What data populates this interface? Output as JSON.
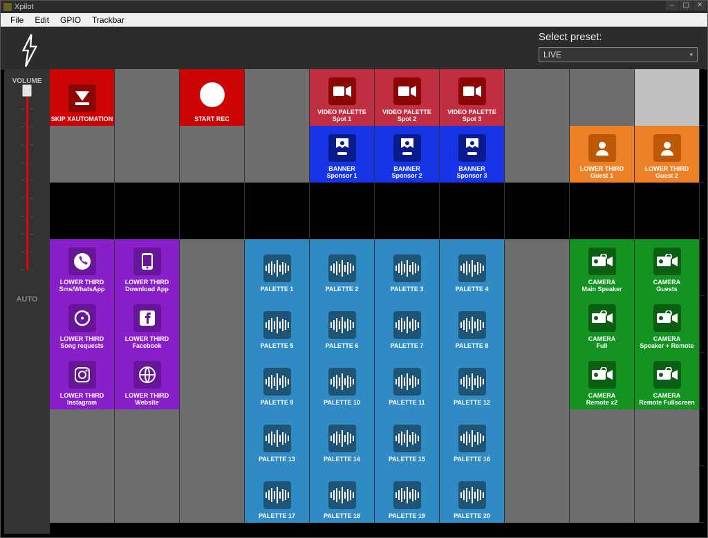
{
  "window": {
    "title": "Xpilot"
  },
  "menu": [
    "File",
    "Edit",
    "GPIO",
    "Trackbar"
  ],
  "preset": {
    "label": "Select preset:",
    "value": "LIVE"
  },
  "sidebar": {
    "volume_label": "VOLUME",
    "auto_label": "AUTO"
  },
  "grid": {
    "rows": [
      [
        {
          "bg": "c-red",
          "line1": "SKIP XAUTOMATION",
          "line2": "",
          "icon": "download-triangle",
          "ib": "ib-darkred",
          "name": "btn-skip-xautomation"
        },
        {
          "bg": "grey"
        },
        {
          "bg": "c-red",
          "line1": "START REC",
          "line2": "",
          "icon": "circle-plain",
          "ib": "",
          "name": "btn-start-rec"
        },
        {
          "bg": "grey"
        },
        {
          "bg": "c-crim",
          "line1": "VIDEO PALETTE",
          "line2": "Spot 1",
          "icon": "video-cam",
          "ib": "ib-darkred",
          "name": "btn-video-palette-1"
        },
        {
          "bg": "c-crim",
          "line1": "VIDEO PALETTE",
          "line2": "Spot 2",
          "icon": "video-cam",
          "ib": "ib-darkred",
          "name": "btn-video-palette-2"
        },
        {
          "bg": "c-crim",
          "line1": "VIDEO PALETTE",
          "line2": "Spot 3",
          "icon": "video-cam",
          "ib": "ib-darkred",
          "name": "btn-video-palette-3"
        },
        {
          "bg": "grey"
        },
        {
          "bg": "grey"
        },
        {
          "bg": "ltgrey"
        }
      ],
      [
        {
          "bg": "grey"
        },
        {
          "bg": "grey"
        },
        {
          "bg": "grey"
        },
        {
          "bg": "grey"
        },
        {
          "bg": "c-blue",
          "line1": "BANNER",
          "line2": "Sponsor 1",
          "icon": "banner-person",
          "ib": "ib-darkblue",
          "name": "btn-banner-1"
        },
        {
          "bg": "c-blue",
          "line1": "BANNER",
          "line2": "Sponsor 2",
          "icon": "banner-person",
          "ib": "ib-darkblue",
          "name": "btn-banner-2"
        },
        {
          "bg": "c-blue",
          "line1": "BANNER",
          "line2": "Sponsor 3",
          "icon": "banner-person",
          "ib": "ib-darkblue",
          "name": "btn-banner-3"
        },
        {
          "bg": "grey"
        },
        {
          "bg": "c-orange",
          "line1": "LOWER THIRD",
          "line2": "Guest 1",
          "icon": "user-card",
          "ib": "ib-dorange",
          "name": "btn-lower-third-guest-1"
        },
        {
          "bg": "c-orange",
          "line1": "LOWER THIRD",
          "line2": "Guest 2",
          "icon": "user-card",
          "ib": "ib-dorange",
          "name": "btn-lower-third-guest-2"
        }
      ],
      [
        {
          "bg": "empty"
        },
        {
          "bg": "empty"
        },
        {
          "bg": "empty"
        },
        {
          "bg": "empty"
        },
        {
          "bg": "empty"
        },
        {
          "bg": "empty"
        },
        {
          "bg": "empty"
        },
        {
          "bg": "empty"
        },
        {
          "bg": "empty"
        },
        {
          "bg": "empty"
        }
      ],
      [
        {
          "bg": "c-purple",
          "line1": "LOWER THIRD",
          "line2": "Sms/WhatsApp",
          "icon": "phone-circle",
          "ib": "ib-darkpurple",
          "name": "btn-lt-sms"
        },
        {
          "bg": "c-purple",
          "line1": "LOWER THIRD",
          "line2": "Download App",
          "icon": "phone-rect",
          "ib": "ib-darkpurple",
          "name": "btn-lt-download"
        },
        {
          "bg": "grey"
        },
        {
          "bg": "c-steel",
          "line1": "PALETTE 1",
          "line2": "",
          "icon": "wave",
          "ib": "ib-teal",
          "name": "btn-palette-1"
        },
        {
          "bg": "c-steel",
          "line1": "PALETTE 2",
          "line2": "",
          "icon": "wave",
          "ib": "ib-teal",
          "name": "btn-palette-2"
        },
        {
          "bg": "c-steel",
          "line1": "PALETTE 3",
          "line2": "",
          "icon": "wave",
          "ib": "ib-teal",
          "name": "btn-palette-3"
        },
        {
          "bg": "c-steel",
          "line1": "PALETTE 4",
          "line2": "",
          "icon": "wave",
          "ib": "ib-teal",
          "name": "btn-palette-4"
        },
        {
          "bg": "grey"
        },
        {
          "bg": "c-green",
          "line1": "CAMERA",
          "line2": "Main Speaker",
          "icon": "camera",
          "ib": "ib-dgreen",
          "name": "btn-cam-main"
        },
        {
          "bg": "c-green",
          "line1": "CAMERA",
          "line2": "Guests",
          "icon": "camera",
          "ib": "ib-dgreen",
          "name": "btn-cam-guests"
        }
      ],
      [
        {
          "bg": "c-purple",
          "line1": "LOWER THIRD",
          "line2": "Song requests",
          "icon": "disc",
          "ib": "ib-darkpurple",
          "name": "btn-lt-song"
        },
        {
          "bg": "c-purple",
          "line1": "LOWER THIRD",
          "line2": "Facebook",
          "icon": "facebook",
          "ib": "ib-darkpurple",
          "name": "btn-lt-facebook"
        },
        {
          "bg": "grey"
        },
        {
          "bg": "c-steel",
          "line1": "PALETTE 5",
          "line2": "",
          "icon": "wave",
          "ib": "ib-teal",
          "name": "btn-palette-5"
        },
        {
          "bg": "c-steel",
          "line1": "PALETTE 6",
          "line2": "",
          "icon": "wave",
          "ib": "ib-teal",
          "name": "btn-palette-6"
        },
        {
          "bg": "c-steel",
          "line1": "PALETTE 7",
          "line2": "",
          "icon": "wave",
          "ib": "ib-teal",
          "name": "btn-palette-7"
        },
        {
          "bg": "c-steel",
          "line1": "PALETTE 8",
          "line2": "",
          "icon": "wave",
          "ib": "ib-teal",
          "name": "btn-palette-8"
        },
        {
          "bg": "grey"
        },
        {
          "bg": "c-green",
          "line1": "CAMERA",
          "line2": "Full",
          "icon": "camera",
          "ib": "ib-dgreen",
          "name": "btn-cam-full"
        },
        {
          "bg": "c-green",
          "line1": "CAMERA",
          "line2": "Speaker + Remote",
          "icon": "camera",
          "ib": "ib-dgreen",
          "name": "btn-cam-speaker-remote"
        }
      ],
      [
        {
          "bg": "c-purple",
          "line1": "LOWER THIRD",
          "line2": "Instagram",
          "icon": "instagram",
          "ib": "ib-darkpurple",
          "name": "btn-lt-instagram"
        },
        {
          "bg": "c-purple",
          "line1": "LOWER THIRD",
          "line2": "Website",
          "icon": "globe",
          "ib": "ib-darkpurple",
          "name": "btn-lt-website"
        },
        {
          "bg": "grey"
        },
        {
          "bg": "c-steel",
          "line1": "PALETTE 9",
          "line2": "",
          "icon": "wave",
          "ib": "ib-teal",
          "name": "btn-palette-9"
        },
        {
          "bg": "c-steel",
          "line1": "PALETTE 10",
          "line2": "",
          "icon": "wave",
          "ib": "ib-teal",
          "name": "btn-palette-10"
        },
        {
          "bg": "c-steel",
          "line1": "PALETTE 11",
          "line2": "",
          "icon": "wave",
          "ib": "ib-teal",
          "name": "btn-palette-11"
        },
        {
          "bg": "c-steel",
          "line1": "PALETTE 12",
          "line2": "",
          "icon": "wave",
          "ib": "ib-teal",
          "name": "btn-palette-12"
        },
        {
          "bg": "grey"
        },
        {
          "bg": "c-green",
          "line1": "CAMERA",
          "line2": "Remote x2",
          "icon": "camera",
          "ib": "ib-dgreen",
          "name": "btn-cam-remote-x2"
        },
        {
          "bg": "c-green",
          "line1": "CAMERA",
          "line2": "Remote Fullscreen",
          "icon": "camera",
          "ib": "ib-dgreen",
          "name": "btn-cam-remote-full"
        }
      ],
      [
        {
          "bg": "grey"
        },
        {
          "bg": "grey"
        },
        {
          "bg": "grey"
        },
        {
          "bg": "c-steel",
          "line1": "PALETTE 13",
          "line2": "",
          "icon": "wave",
          "ib": "ib-teal",
          "name": "btn-palette-13"
        },
        {
          "bg": "c-steel",
          "line1": "PALETTE 14",
          "line2": "",
          "icon": "wave",
          "ib": "ib-teal",
          "name": "btn-palette-14"
        },
        {
          "bg": "c-steel",
          "line1": "PALETTE 15",
          "line2": "",
          "icon": "wave",
          "ib": "ib-teal",
          "name": "btn-palette-15"
        },
        {
          "bg": "c-steel",
          "line1": "PALETTE 16",
          "line2": "",
          "icon": "wave",
          "ib": "ib-teal",
          "name": "btn-palette-16"
        },
        {
          "bg": "grey"
        },
        {
          "bg": "grey"
        },
        {
          "bg": "grey"
        }
      ],
      [
        {
          "bg": "grey"
        },
        {
          "bg": "grey"
        },
        {
          "bg": "grey"
        },
        {
          "bg": "c-steel",
          "line1": "PALETTE 17",
          "line2": "",
          "icon": "wave",
          "ib": "ib-teal",
          "name": "btn-palette-17"
        },
        {
          "bg": "c-steel",
          "line1": "PALETTE 18",
          "line2": "",
          "icon": "wave",
          "ib": "ib-teal",
          "name": "btn-palette-18"
        },
        {
          "bg": "c-steel",
          "line1": "PALETTE 19",
          "line2": "",
          "icon": "wave",
          "ib": "ib-teal",
          "name": "btn-palette-19"
        },
        {
          "bg": "c-steel",
          "line1": "PALETTE 20",
          "line2": "",
          "icon": "wave",
          "ib": "ib-teal",
          "name": "btn-palette-20"
        },
        {
          "bg": "grey"
        },
        {
          "bg": "grey"
        },
        {
          "bg": "grey"
        }
      ]
    ]
  }
}
